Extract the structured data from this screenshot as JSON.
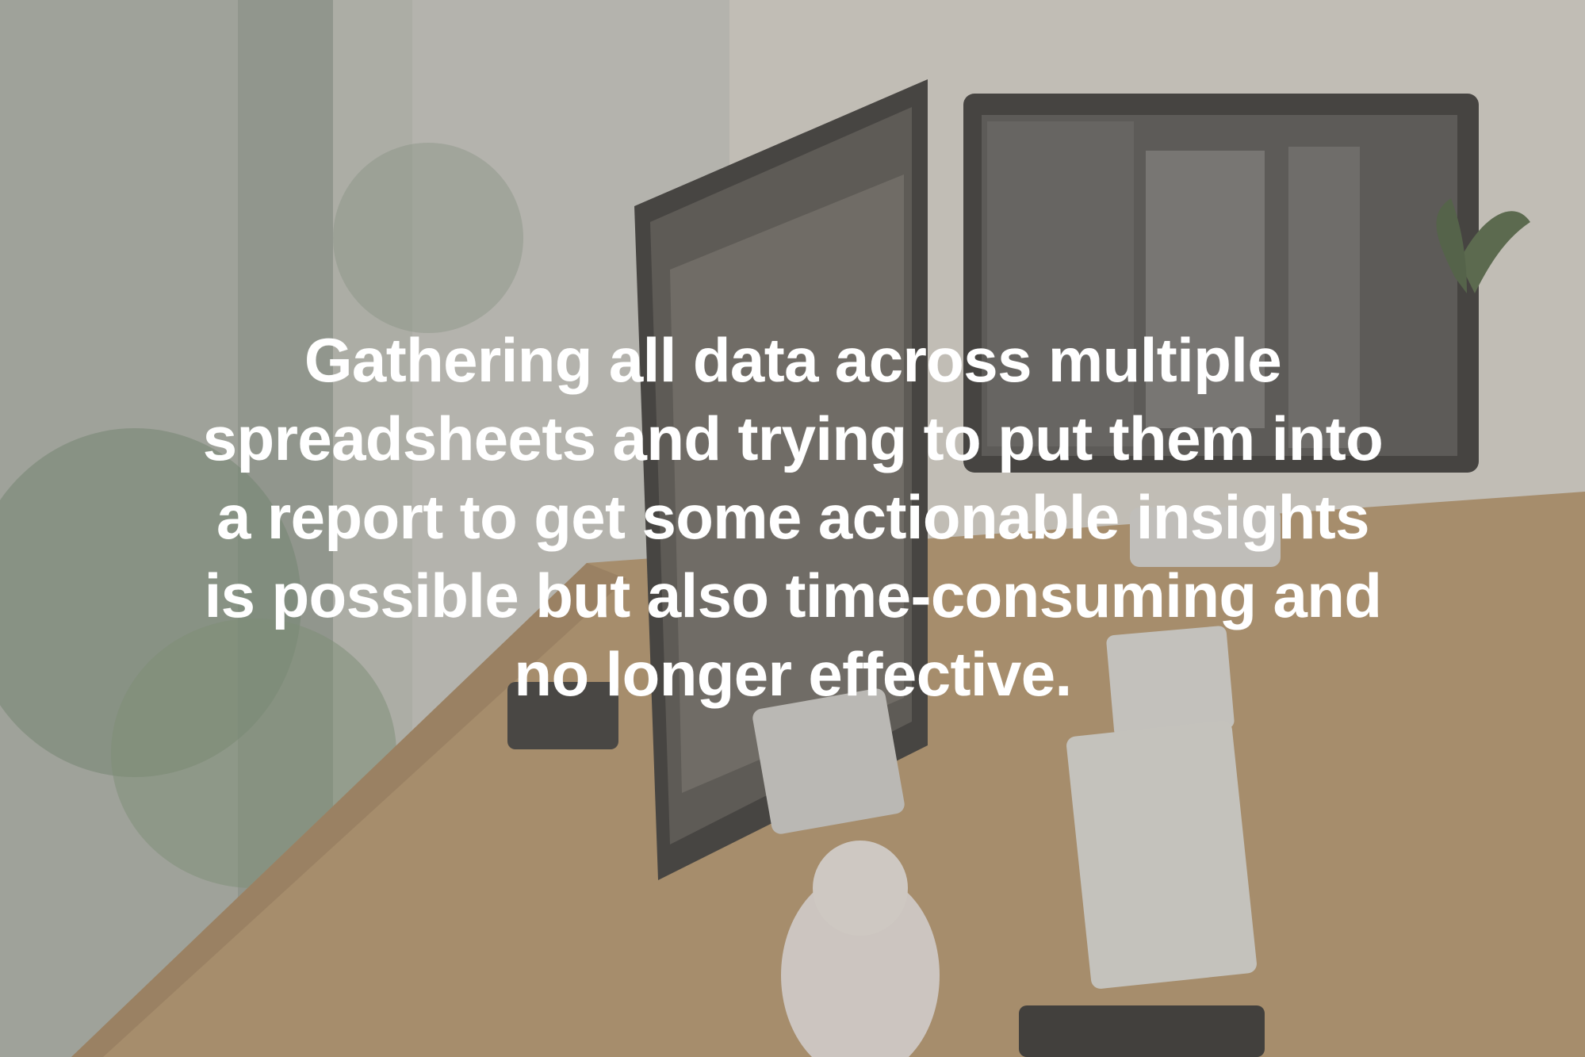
{
  "quote": {
    "text": "Gathering all data across multiple\nspreadsheets and trying to put them into\na report to get some actionable insights\nis possible but also time-consuming and\nno longer effective."
  },
  "colors": {
    "overlay": "#807C72",
    "text": "#FFFFFF",
    "desk": "#B99669",
    "monitor_frame": "#2A2A2A"
  }
}
